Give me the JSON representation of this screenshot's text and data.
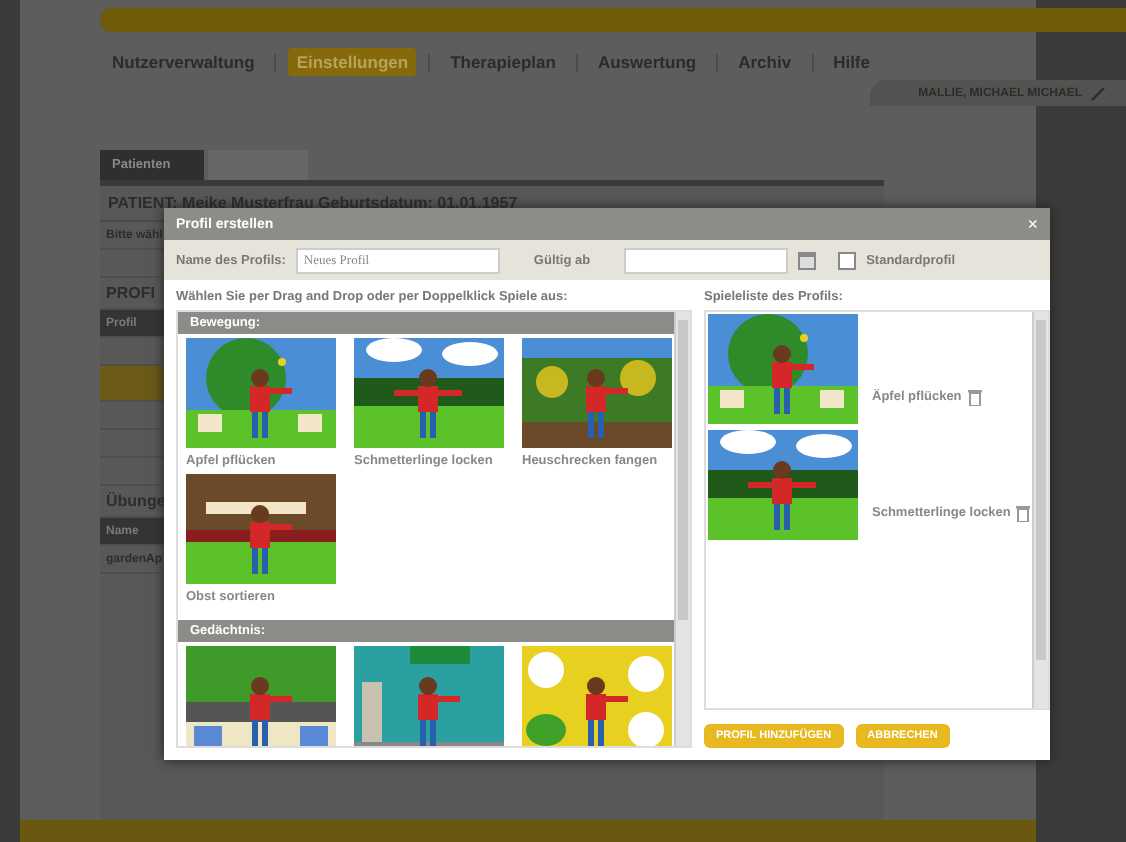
{
  "nav": [
    {
      "label": "Nutzerverwaltung",
      "selected": false
    },
    {
      "label": "Einstellungen",
      "selected": true
    },
    {
      "label": "Therapieplan",
      "selected": false
    },
    {
      "label": "Auswertung",
      "selected": false
    },
    {
      "label": "Archiv",
      "selected": false
    },
    {
      "label": "Hilfe",
      "selected": false
    }
  ],
  "user": "MALLIE, MICHAEL MICHAEL",
  "tabs": [
    {
      "label": "Patienten",
      "selected": true
    },
    {
      "selected": false
    }
  ],
  "patient_header": "PATIENT: Meike Musterfrau Geburtsdatum: 01.01.1957",
  "left_rows": [
    {
      "kind": "plain",
      "text": "Bitte wähl"
    },
    {
      "kind": "blank"
    },
    {
      "kind": "heading",
      "text": "PROFI"
    },
    {
      "kind": "dark",
      "text": "Profil"
    },
    {
      "kind": "blank"
    },
    {
      "kind": "highlight"
    },
    {
      "kind": "blank"
    },
    {
      "kind": "blank"
    },
    {
      "kind": "blank"
    },
    {
      "kind": "heading",
      "text": "Übunge"
    },
    {
      "kind": "dark",
      "text": "Name"
    },
    {
      "kind": "plain",
      "text": "gardenAp"
    }
  ],
  "dialog": {
    "title": "Profil erstellen",
    "close": "×",
    "name_label": "Name des Profils:",
    "name_value": "Neues Profil",
    "valid_label": "Gültig ab",
    "standard": {
      "label": "Standardprofil",
      "checked": false
    },
    "instruction": "Wählen Sie per Drag and Drop oder per Doppelklick Spiele aus:",
    "sections": [
      {
        "title": "Bewegung:",
        "games": [
          {
            "name": "Apfel pflücken",
            "kind": "picture"
          },
          {
            "name": "Schmetterlinge locken",
            "kind": "picture"
          },
          {
            "name": "Heuschrecken fangen",
            "kind": "picture"
          },
          {
            "name": "Obst sortieren",
            "kind": "picture"
          }
        ]
      },
      {
        "title": "Gedächtnis:"
      }
    ],
    "playlist_title": "Spieleliste des Profils:",
    "playlist": [
      {
        "name": "Äpfel pflücken",
        "kind": "picture"
      },
      {
        "name": "Schmetterlinge locken",
        "kind": "picture"
      }
    ],
    "buttons": [
      "PROFIL HINZUFÜGEN",
      "ABBRECHEN"
    ]
  }
}
